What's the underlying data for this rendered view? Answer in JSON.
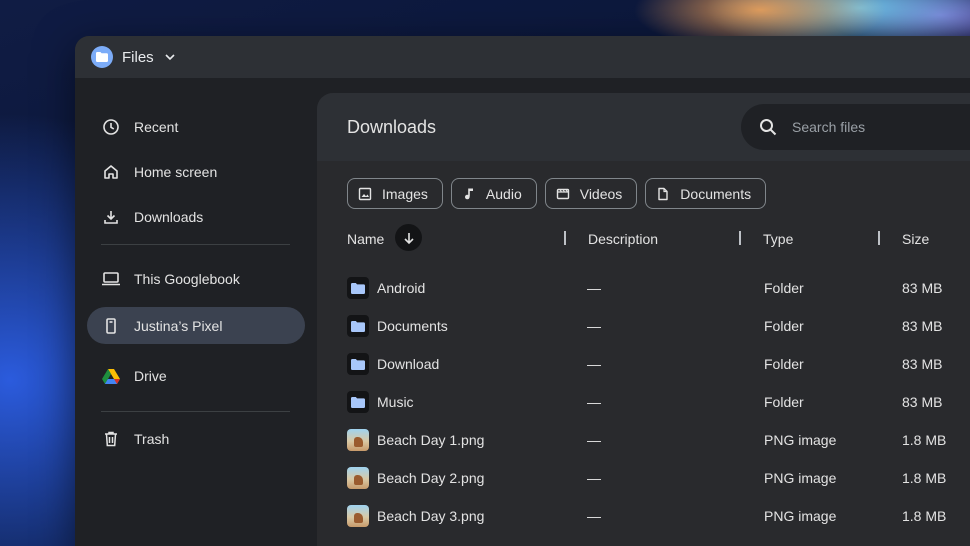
{
  "app": {
    "title": "Files"
  },
  "sidebar": {
    "items": [
      {
        "label": "Recent",
        "icon": "clock-icon"
      },
      {
        "label": "Home screen",
        "icon": "home-icon"
      },
      {
        "label": "Downloads",
        "icon": "download-icon"
      },
      {
        "label": "This Googlebook",
        "icon": "laptop-icon"
      },
      {
        "label": "Justina’s Pixel",
        "icon": "phone-icon",
        "active": true
      },
      {
        "label": "Drive",
        "icon": "google-drive-icon"
      },
      {
        "label": "Trash",
        "icon": "trash-icon"
      }
    ]
  },
  "main": {
    "title": "Downloads",
    "search": {
      "placeholder": "Search files"
    },
    "chips": [
      {
        "label": "Images",
        "icon": "image-icon"
      },
      {
        "label": "Audio",
        "icon": "music-note-icon"
      },
      {
        "label": "Videos",
        "icon": "film-icon"
      },
      {
        "label": "Documents",
        "icon": "document-icon"
      }
    ],
    "columns": {
      "name": "Name",
      "description": "Description",
      "type": "Type",
      "size": "Size"
    },
    "files": [
      {
        "name": "Android",
        "description": "—",
        "type": "Folder",
        "size": "83 MB",
        "kind": "folder"
      },
      {
        "name": "Documents",
        "description": "—",
        "type": "Folder",
        "size": "83 MB",
        "kind": "folder"
      },
      {
        "name": "Download",
        "description": "—",
        "type": "Folder",
        "size": "83 MB",
        "kind": "folder"
      },
      {
        "name": "Music",
        "description": "—",
        "type": "Folder",
        "size": "83 MB",
        "kind": "folder"
      },
      {
        "name": "Beach Day 1.png",
        "description": "—",
        "type": "PNG image",
        "size": "1.8 MB",
        "kind": "image"
      },
      {
        "name": "Beach Day 2.png",
        "description": "—",
        "type": "PNG image",
        "size": "1.8 MB",
        "kind": "image"
      },
      {
        "name": "Beach Day 3.png",
        "description": "—",
        "type": "PNG image",
        "size": "1.8 MB",
        "kind": "image"
      }
    ]
  },
  "colors": {
    "accent": "#7cacf8",
    "active_nav": "#3b4250",
    "window_bg": "#1f2125",
    "panel_bg": "#292a2d"
  }
}
